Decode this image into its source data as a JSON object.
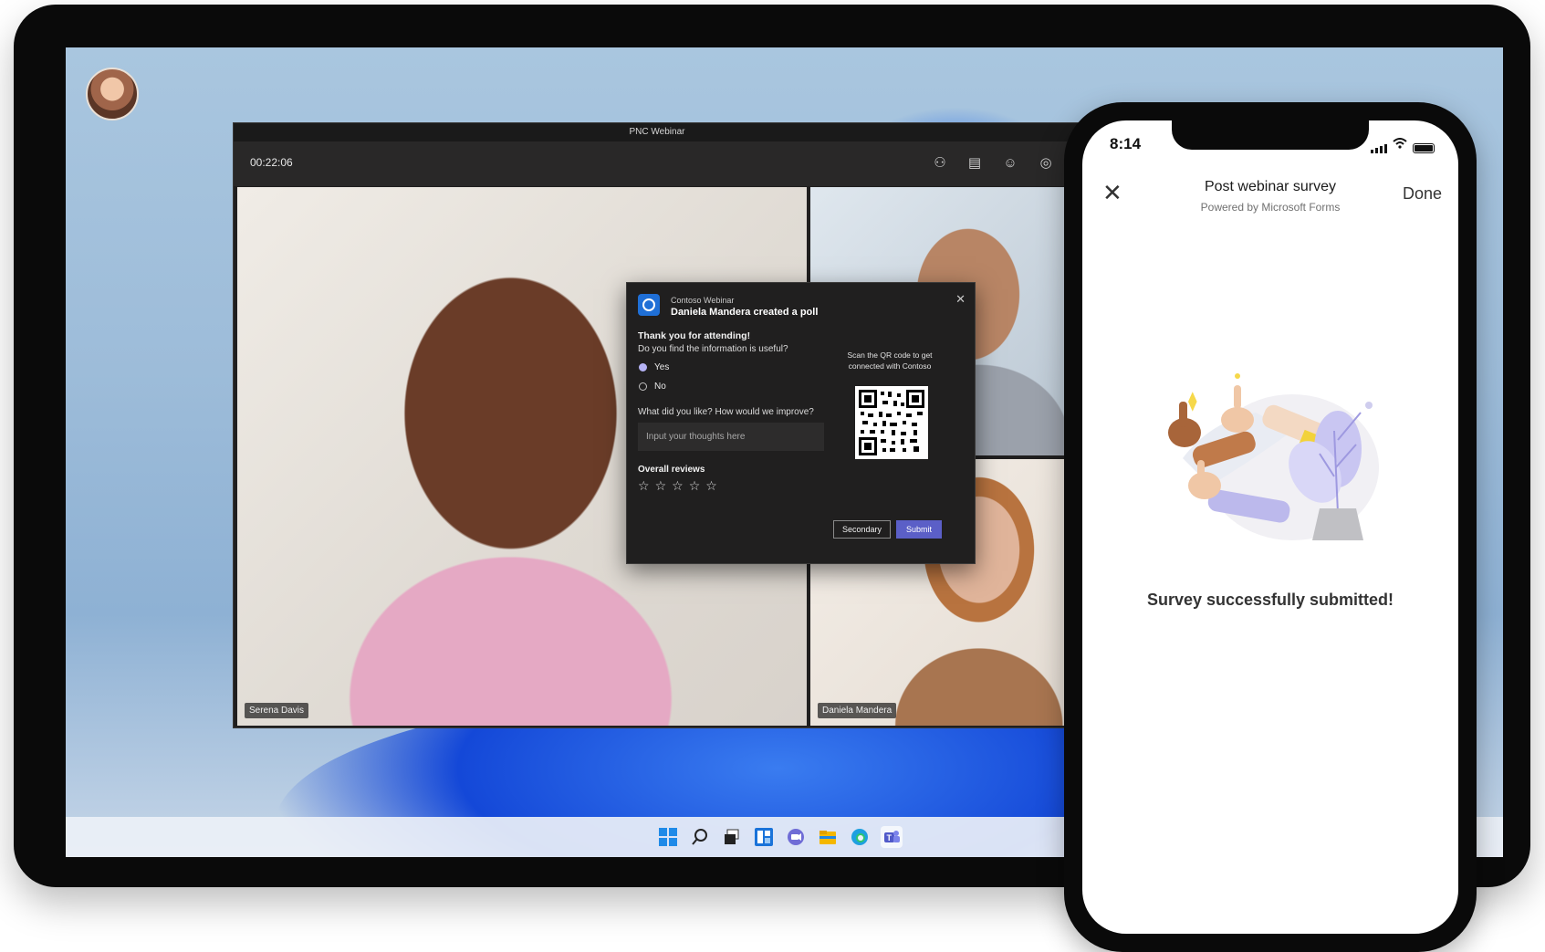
{
  "desktop": {
    "window_title": "PNC Webinar",
    "timer": "00:22:06",
    "toolbar_icons": [
      "people-icon",
      "chat-icon",
      "react-icon",
      "record-icon",
      "more-icon"
    ],
    "participants": [
      {
        "name": "Serena Davis"
      },
      {
        "name": ""
      },
      {
        "name": "Daniela Mandera"
      }
    ],
    "taskbar_icons": [
      "windows-start-icon",
      "search-icon",
      "task-view-icon",
      "widgets-icon",
      "teams-chat-icon",
      "file-explorer-icon",
      "edge-icon",
      "teams-icon"
    ]
  },
  "poll": {
    "app_name": "Contoso Webinar",
    "creator": "Daniela Mandera created a poll",
    "thanks": "Thank you for attending!",
    "question1": "Do you find the information is useful?",
    "options": [
      {
        "label": "Yes",
        "selected": true
      },
      {
        "label": "No",
        "selected": false
      }
    ],
    "question2": "What did you like? How would we improve?",
    "input_placeholder": "Input your thoughts here",
    "reviews_label": "Overall reviews",
    "stars": {
      "rating": 0,
      "max": 5
    },
    "qr_text": "Scan the QR code to get connected with Contoso",
    "secondary_label": "Secondary",
    "submit_label": "Submit",
    "accent": "#5b5fc7"
  },
  "phone": {
    "time": "8:14",
    "title": "Post webinar survey",
    "subtitle": "Powered by Microsoft Forms",
    "done_label": "Done",
    "message": "Survey successfully submitted!"
  }
}
